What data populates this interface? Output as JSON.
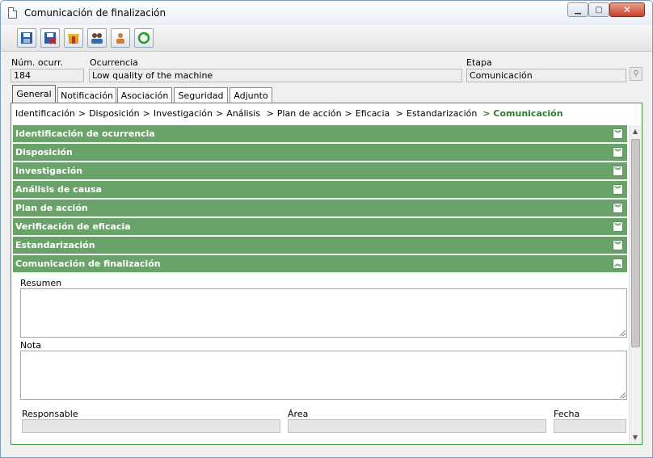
{
  "window": {
    "title": "Comunicación de finalización"
  },
  "header": {
    "num_label": "Núm. ocurr.",
    "num_value": "184",
    "occ_label": "Ocurrencia",
    "occ_value": "Low quality of the machine",
    "stage_label": "Etapa",
    "stage_value": "Comunicación"
  },
  "tabs": [
    "General",
    "Notificación",
    "Asociación",
    "Seguridad",
    "Adjunto"
  ],
  "breadcrumb": {
    "items": [
      "Identificación",
      "Disposición",
      "Investigación",
      "Análisis",
      "Plan de acción",
      "Eficacia",
      "Estandarización"
    ],
    "current": "> Comunicación"
  },
  "sections": [
    "Identificación de ocurrencia",
    "Disposición",
    "Investigación",
    "Análisis de causa",
    "Plan de acción",
    "Verificación de eficacia",
    "Estandarización",
    "Comunicación de finalización"
  ],
  "form": {
    "summary_label": "Resumen",
    "note_label": "Nota",
    "responsible_label": "Responsable",
    "area_label": "Área",
    "date_label": "Fecha"
  },
  "colors": {
    "accent": "#6aa36a",
    "current_step": "#2f7a2f"
  }
}
